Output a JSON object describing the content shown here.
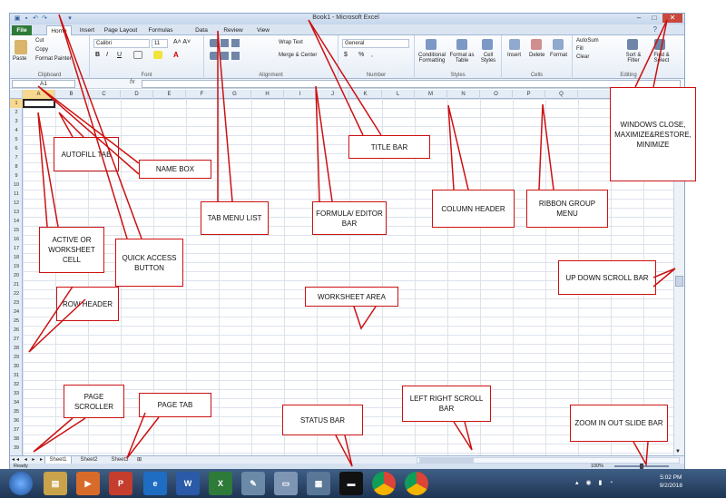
{
  "window": {
    "title": "Book1 - Microsoft Excel",
    "controls": [
      "–",
      "□",
      "✕"
    ]
  },
  "tabs": [
    "File",
    "Home",
    "Insert",
    "Page Layout",
    "Formulas",
    "Data",
    "Review",
    "View"
  ],
  "ribbon": {
    "clipboard": {
      "paste": "Paste",
      "cut": "Cut",
      "copy": "Copy",
      "painter": "Format Painter",
      "label": "Clipboard"
    },
    "font": {
      "name": "Calibri",
      "size": "11",
      "bold": "B",
      "italic": "I",
      "underline": "U",
      "label": "Font"
    },
    "alignment": {
      "wrap": "Wrap Text",
      "merge": "Merge & Center",
      "label": "Alignment"
    },
    "number": {
      "format": "General",
      "currency": "$",
      "percent": "%",
      "comma": ",",
      "label": "Number"
    },
    "styles": {
      "conditional": "Conditional Formatting",
      "table": "Format as Table",
      "cell": "Cell Styles",
      "label": "Styles"
    },
    "cells": {
      "insert": "Insert",
      "delete": "Delete",
      "format": "Format",
      "label": "Cells"
    },
    "editing": {
      "autosum": "AutoSum",
      "fill": "Fill",
      "clear": "Clear",
      "sort": "Sort & Filter",
      "find": "Find & Select",
      "label": "Editing"
    }
  },
  "formula_bar": {
    "name_box": "A1",
    "fx": "fx",
    "value": ""
  },
  "columns": [
    "A",
    "B",
    "C",
    "D",
    "E",
    "F",
    "G",
    "H",
    "I",
    "J",
    "K",
    "L",
    "M",
    "N",
    "O",
    "P",
    "Q"
  ],
  "rows": [
    "1",
    "2",
    "3",
    "4",
    "5",
    "6",
    "7",
    "8",
    "9",
    "10",
    "11",
    "12",
    "13",
    "14",
    "15",
    "16",
    "17",
    "18",
    "19",
    "20",
    "21",
    "22",
    "23",
    "24",
    "25",
    "26",
    "27",
    "28",
    "29",
    "30",
    "31",
    "32",
    "33",
    "34",
    "35",
    "36",
    "37",
    "38",
    "39"
  ],
  "sheets": [
    "Sheet1",
    "Sheet2",
    "Sheet3"
  ],
  "status": {
    "text": "Ready",
    "zoom": "100%"
  },
  "taskbar": {
    "time": "5:02 PM",
    "date": "9/2/2018"
  },
  "callouts": {
    "autofill": "AUTOFILL TAB",
    "name_box": "NAME BOX",
    "title_bar": "TITLE BAR",
    "window_ctrls": "WINDOWS CLOSE, MAXIMIZE&RESTORE, MINIMIZE",
    "tab_menu": "TAB MENU LIST",
    "formula": "FORMULA/ EDITOR BAR",
    "column_header": "COLUMN HEADER",
    "ribbon_group": "RIBBON GROUP MENU",
    "active_cell": "ACTIVE OR WORKSHEET CELL",
    "quick_access": "QUICK ACCESS BUTTON",
    "row_header": "ROW HEADER",
    "worksheet": "WORKSHEET AREA",
    "updown": "UP DOWN SCROLL BAR",
    "page_scroller": "PAGE SCROLLER",
    "page_tab": "PAGE TAB",
    "status_bar": "STATUS BAR",
    "leftright": "LEFT RIGHT SCROLL BAR",
    "zoom": "ZOOM IN OUT SLIDE BAR"
  }
}
